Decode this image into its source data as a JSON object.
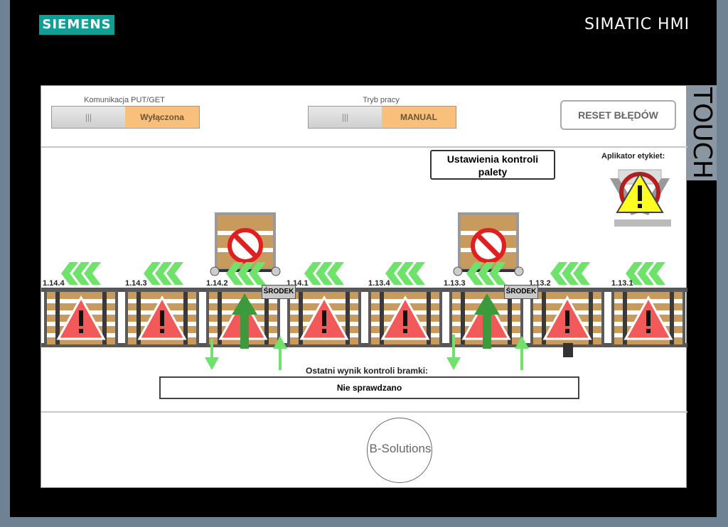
{
  "header": {
    "brand": "SIEMENS",
    "product": "SIMATIC HMI",
    "side_label": "TOUCH"
  },
  "controls": {
    "communication": {
      "label": "Komunikacja PUT/GET",
      "knob": "|||",
      "state": "Wyłączona"
    },
    "mode": {
      "label": "Tryb pracy",
      "knob": "|||",
      "state": "MANUAL"
    },
    "reset_label": "RESET BŁĘDÓW"
  },
  "pallet_settings_label": "Ustawienia kontroli palety",
  "applicator_label": "Aplikator etykiet:",
  "positions": [
    "1.14.4",
    "1.14.3",
    "1.14.2",
    "1.14.1",
    "1.13.4",
    "1.13.3",
    "1.13.2",
    "1.13.1"
  ],
  "center_label": "ŚRODEK",
  "result": {
    "label": "Ostatni wynik kontroli bramki:",
    "value": "Nie sprawdzano"
  },
  "footer": {
    "brand": "B-Solutions"
  },
  "colors": {
    "siemens": "#119e97",
    "switch_state": "#f9c07b",
    "warning_red": "#f25a5a",
    "arrow_green": "#6ee26a",
    "pallet_wood": "#c89a5e"
  }
}
